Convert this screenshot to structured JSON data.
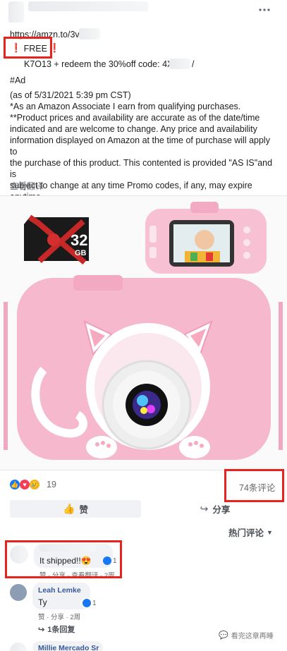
{
  "post": {
    "link": "https://amzn.to/3v",
    "free_label": "FREE",
    "code_line": "K7O13 + redeem the 30%off code: 4XQ",
    "code_suffix": "/",
    "hashtag": "#Ad",
    "disclaimer": [
      "(as of 5/31/2021 5:39 pm CST)",
      "*As an Amazon Associate I earn from qualifying purchases.",
      "**Product prices and availability are accurate as of the date/time",
      "indicated and are welcome to change. Any price and availability",
      "information displayed on Amazon at the time of purchase will apply to",
      "the purchase of this product. This contented is provided \"AS IS\"and is",
      "subject to change at any time  Promo codes, if any, may expire",
      "anytime."
    ],
    "translate": "查看翻译",
    "more_icon": "more-dots-icon",
    "sd_card_label": "32",
    "sd_card_sub": "GB"
  },
  "stats": {
    "reaction_count": "19",
    "comment_count": "74条评论"
  },
  "actions": {
    "like": "赞",
    "share": "分享"
  },
  "comments_header": {
    "sort": "热门评论"
  },
  "comments": [
    {
      "author": "",
      "text": "It shipped!!",
      "emoji": "😍",
      "meta": "赞 · 分享 · 查看翻译 · 2周",
      "reaction_count": "1"
    },
    {
      "author": "Leah Lemke",
      "text": "Ty",
      "meta": "赞 · 分享 · 2周",
      "reaction_count": "1",
      "replies": "1条回复"
    },
    {
      "author": "Millie Mercado Sr",
      "text": ""
    }
  ],
  "watermark": "看完这章再睡",
  "colors": {
    "accent": "#385898",
    "highlight": "#e8231e",
    "camera_pink": "#f5b8cc"
  }
}
